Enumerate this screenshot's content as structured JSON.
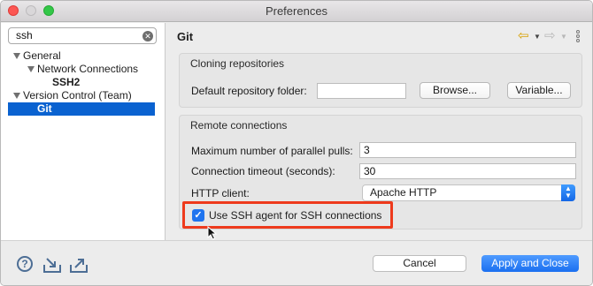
{
  "window": {
    "title": "Preferences"
  },
  "filter": {
    "value": "ssh"
  },
  "tree": {
    "items": [
      {
        "label": "General",
        "level": 0,
        "expanded": true
      },
      {
        "label": "Network Connections",
        "level": 1,
        "expanded": true
      },
      {
        "label": "SSH2",
        "level": 2,
        "bold": true
      },
      {
        "label": "Version Control (Team)",
        "level": 0,
        "expanded": true
      },
      {
        "label": "Git",
        "level": 1,
        "selected": true
      }
    ]
  },
  "page": {
    "title": "Git"
  },
  "cloning": {
    "title": "Cloning repositories",
    "default_folder_label": "Default repository folder:",
    "default_folder_value": "",
    "browse_label": "Browse...",
    "variable_label": "Variable..."
  },
  "remote": {
    "title": "Remote connections",
    "parallel_pulls_label": "Maximum number of parallel pulls:",
    "parallel_pulls_value": "3",
    "timeout_label": "Connection timeout (seconds):",
    "timeout_value": "30",
    "http_client_label": "HTTP client:",
    "http_client_value": "Apache HTTP",
    "ssh_agent_label": "Use SSH agent for SSH connections",
    "ssh_agent_checked": true
  },
  "footer": {
    "cancel_label": "Cancel",
    "apply_close_label": "Apply and Close"
  },
  "colors": {
    "accent": "#1a6ff0",
    "selection": "#0a62d0",
    "highlight_box": "#ee3a1c"
  }
}
